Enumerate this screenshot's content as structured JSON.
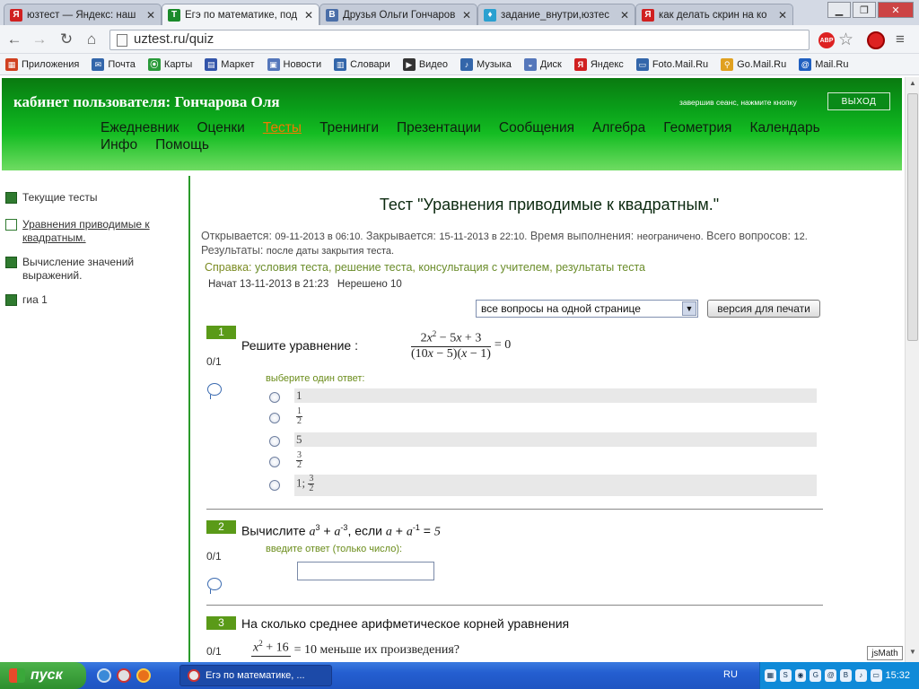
{
  "browser": {
    "tabs": [
      {
        "title": "юзтест — Яндекс: наш",
        "favicon": "Я",
        "color": "#d02020"
      },
      {
        "title": "Егэ по математике, под",
        "favicon": "T",
        "color": "#1a8a2a"
      },
      {
        "title": "Друзья Ольги Гончаров",
        "favicon": "B",
        "color": "#4a6ea8"
      },
      {
        "title": "задание_внутри,юзтес",
        "favicon": "♦",
        "color": "#2aa0d0"
      },
      {
        "title": "как делать скрин на ко",
        "favicon": "Я",
        "color": "#d02020"
      }
    ],
    "url": "uztest.ru/quiz",
    "bookmarks": [
      {
        "label": "Приложения",
        "icon": "apps-icon",
        "color": "#d04020"
      },
      {
        "label": "Почта",
        "icon": "mail-icon",
        "color": "#3366aa"
      },
      {
        "label": "Карты",
        "icon": "maps-icon",
        "color": "#2a9a3a"
      },
      {
        "label": "Маркет",
        "icon": "market-icon",
        "color": "#3355aa"
      },
      {
        "label": "Новости",
        "icon": "news-icon",
        "color": "#5577bb"
      },
      {
        "label": "Словари",
        "icon": "dictionary-icon",
        "color": "#3366aa"
      },
      {
        "label": "Видео",
        "icon": "video-icon",
        "color": "#333333"
      },
      {
        "label": "Музыка",
        "icon": "music-icon",
        "color": "#3366aa"
      },
      {
        "label": "Диск",
        "icon": "disk-icon",
        "color": "#5577bb"
      },
      {
        "label": "Яндекс",
        "icon": "yandex-icon",
        "color": "#d02020"
      },
      {
        "label": "Foto.Mail.Ru",
        "icon": "foto-mail-icon",
        "color": "#3366aa"
      },
      {
        "label": "Go.Mail.Ru",
        "icon": "go-mail-icon",
        "color": "#e0a020"
      },
      {
        "label": "Mail.Ru",
        "icon": "mailru-icon",
        "color": "#2060c0"
      }
    ]
  },
  "header": {
    "cabinet": "кабинет пользователя: Гончарова Оля",
    "session_text": "завершив сеанс, нажмите кнопку",
    "logout": "ВЫХОД",
    "nav": [
      {
        "label": "Ежедневник",
        "active": false
      },
      {
        "label": "Оценки",
        "active": false
      },
      {
        "label": "Тесты",
        "active": true
      },
      {
        "label": "Тренинги",
        "active": false
      },
      {
        "label": "Презентации",
        "active": false
      },
      {
        "label": "Сообщения",
        "active": false
      },
      {
        "label": "Алгебра",
        "active": false
      },
      {
        "label": "Геометрия",
        "active": false
      },
      {
        "label": "Календарь",
        "active": false
      },
      {
        "label": "Инфо",
        "active": false
      },
      {
        "label": "Помощь",
        "active": false
      }
    ]
  },
  "sidebar": {
    "items": [
      {
        "label": "Текущие тесты",
        "open": false
      },
      {
        "label": "Уравнения приводимые к квадратным.",
        "open": true
      },
      {
        "label": "Вычисление значений выражений.",
        "open": false
      },
      {
        "label": "гиа 1",
        "open": false
      }
    ]
  },
  "test": {
    "title": "Тест \"Уравнения приводимые к квадратным.\"",
    "opens_label": "Открывается:",
    "opens": "09-11-2013 в 06:10.",
    "closes_label": "Закрывается:",
    "closes": "15-11-2013 в 22:10.",
    "duration_label": "Время выполнения:",
    "duration": "неограничено.",
    "total_label": "Всего вопросов:",
    "total": "12.",
    "results_label": "Результаты:",
    "results": "после даты закрытия теста.",
    "help_label": "Справка:",
    "help_links": [
      "условия теста",
      "решение теста",
      "консультация с учителем",
      "результаты теста"
    ],
    "started": "Начат 13-11-2013 в 21:23",
    "unsolved": "Нерешено 10",
    "view_select": "все вопросы на одной странице",
    "print_button": "версия для печати"
  },
  "questions": [
    {
      "num": "1",
      "score": "0/1",
      "text": "Решите уравнение :",
      "hint": "выберите один ответ:",
      "answers": [
        "1",
        "1/2",
        "5",
        "3/2",
        "1; 3/2"
      ]
    },
    {
      "num": "2",
      "score": "0/1",
      "text_prefix": "Вычислите",
      "text_suffix": ", если",
      "hint": "введите ответ (только число):"
    },
    {
      "num": "3",
      "score": "0/1",
      "text": "На сколько среднее арифметическое корней уравнения",
      "text_tail": "= 10 меньше их произведения?"
    }
  ],
  "jsmath": "jsMath",
  "taskbar": {
    "start": "пуск",
    "window": "Егэ по математике, ...",
    "lang": "RU",
    "clock": "15:32"
  }
}
